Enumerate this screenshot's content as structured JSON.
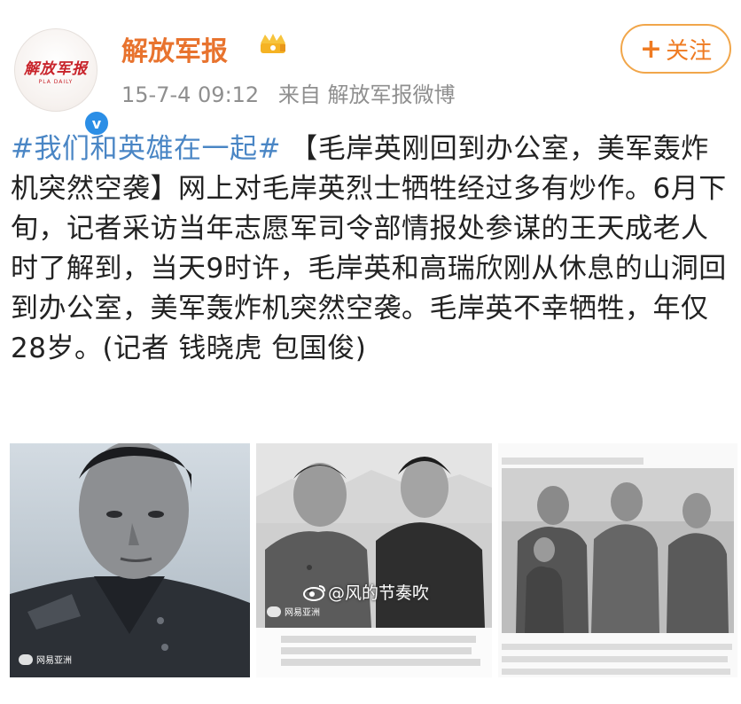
{
  "account": {
    "name": "解放军报",
    "avatar_logo": "解放军报",
    "avatar_sub": "PLA DAILY",
    "verified_mark": "v",
    "time": "15-7-4 09:12",
    "source": "来自 解放军报微博",
    "follow_label": "关注",
    "follow_plus": "+"
  },
  "post": {
    "hashtag": "#我们和英雄在一起#",
    "body": " 【毛岸英刚回到办公室，美军轰炸机突然空袭】网上对毛岸英烈士牺牲经过多有炒作。6月下旬，记者采访当年志愿军司令部情报处参谋的王天成老人时了解到，当天9时许，毛岸英和高瑞欣刚从休息的山洞回到办公室，美军轰炸机突然空袭。毛岸英不幸牺牲，年仅28岁。(记者 钱晓虎 包国俊)"
  },
  "images": [
    {
      "name": "portrait-photo",
      "watermark": "网易亚洲"
    },
    {
      "name": "two-men-photo",
      "watermark": "网易亚洲",
      "weibo_watermark": "@风的节奏吹"
    },
    {
      "name": "group-photo"
    }
  ]
}
